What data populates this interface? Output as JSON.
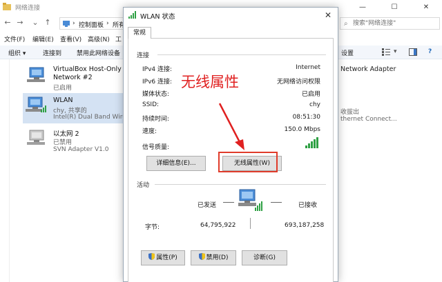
{
  "explorer": {
    "title": "网络连接",
    "window_controls": {
      "minimize": "—",
      "maximize": "☐",
      "close": "✕"
    },
    "breadcrumb": [
      "控制面板",
      "所有"
    ],
    "search_placeholder": "搜索\"网络连接\"",
    "menu": [
      "文件(F)",
      "编辑(E)",
      "查看(V)",
      "高级(N)",
      "工"
    ],
    "toolbar": {
      "organize": "组织 ▾",
      "connect_to": "连接到",
      "disable_device": "禁用此网络设备",
      "change_settings": "设置"
    },
    "connections": [
      {
        "name": "VirtualBox Host-Only",
        "name2": "Network #2",
        "status": "已启用",
        "selected": false
      },
      {
        "name": "WLAN",
        "status": "chy, 共享的",
        "adapter": "Intel(R) Dual Band Wirel",
        "selected": true
      },
      {
        "name": "以太网 2",
        "status": "已禁用",
        "adapter": "SVN Adapter V1.0",
        "selected": false
      }
    ],
    "right_column": {
      "r1": "Network Adapter",
      "r2": "收拔出",
      "r3": "thernet Connect..."
    }
  },
  "dialog": {
    "title": "WLAN 状态",
    "close": "✕",
    "tab": "常规",
    "connection_section": "连接",
    "rows": [
      {
        "label": "IPv4 连接:",
        "value": "Internet"
      },
      {
        "label": "IPv6 连接:",
        "value": "无网络访问权限"
      },
      {
        "label": "媒体状态:",
        "value": "已启用"
      },
      {
        "label": "SSID:",
        "value": "chy"
      },
      {
        "label": "持续时间:",
        "value": "08:51:30"
      },
      {
        "label": "速度:",
        "value": "150.0 Mbps"
      }
    ],
    "signal_label": "信号质量:",
    "signal_bars": 5,
    "details_button": "详细信息(E)...",
    "wireless_props_button": "无线属性(W)",
    "activity_section": "活动",
    "sent_label": "已发送",
    "received_label": "已接收",
    "bytes_label": "字节:",
    "bytes_sent": "64,795,922",
    "bytes_received": "693,187,258",
    "properties_button": "属性(P)",
    "disable_button": "禁用(D)",
    "diagnose_button": "诊断(G)"
  },
  "annotation": {
    "text": "无线属性"
  },
  "colors": {
    "annotation_red": "#e02020",
    "signal_green": "#2ea043",
    "selection": "#d4e2f3"
  }
}
